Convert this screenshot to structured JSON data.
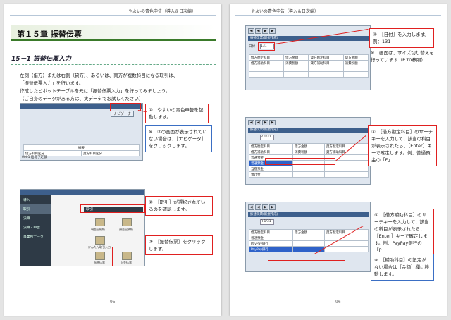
{
  "left_page": {
    "header": "やよいの青色申告（導入＆日次編）",
    "chapter_title": "第１５章 振替伝票",
    "section_title": "15－1 振替伝票入力",
    "body": [
      "左側（借方）または右側（貸方）、あるいは、両方が複数科目になる取引は、",
      "「振替伝票入力」を行います。",
      "作成したピボットテーブルを元に「振替伝票入力」を行ってみましょう。",
      "（ご自身のデータがある方は、実データでお試しください）"
    ],
    "shot1": {
      "nav_label": "ナビゲータ",
      "row_label": "摘要",
      "col1": "借方科目区分",
      "col2": "貸方科目区分",
      "bottom": "0001 給与予定額"
    },
    "callouts": [
      "①　やよいの青色申告を起動します。",
      "※　②の画面が表示されていない場合は、［ナビゲータ］をクリックします。",
      "②　［取引］が選択されているのを確認します。",
      "③　［振替伝票］をクリックします。"
    ],
    "shot2": {
      "menu": [
        "導入",
        "取引",
        "決算",
        "決算・申告",
        "事業所データ"
      ],
      "tab": "取引",
      "icons": [
        "現金出納帳",
        "預金出納帳",
        "かんたん取引入力",
        "振替伝票",
        "入金伝票"
      ]
    },
    "page_number": "95"
  },
  "right_page": {
    "header": "やよいの青色申告（導入＆日次編）",
    "shots": [
      {
        "title": "振替伝票(新規作成)",
        "date": "131",
        "headers": [
          "借方勘定科目",
          "借方金額",
          "貸方勘定科目",
          "貸方金額"
        ],
        "sub": [
          "借方補助科目",
          "消費税額",
          "貸方補助科目",
          "消費税額"
        ]
      },
      {
        "title": "振替伝票(新規作成)",
        "date": "R 1/31",
        "headers": [
          "借方勘定科目",
          "借方金額",
          "貸方勘定科目"
        ],
        "sub": [
          "借方補助科目",
          "消費税額",
          "貸方補助科目"
        ],
        "rows": [
          "普通預金",
          "普通預金",
          "当座預金",
          "預け金"
        ]
      },
      {
        "title": "振替伝票(新規作成)",
        "date": "R 1/31",
        "headers": [
          "借方勘定科目",
          "借方金額",
          "貸方勘定科目"
        ],
        "rows": [
          "普通預金",
          "PayPay銀行",
          "PayPay銀行"
        ]
      }
    ],
    "callouts": [
      "④　［日付］を入力します。例：131",
      "※　画面は、サイズ切り替えを行っています（P.70参照）",
      "⑤　［借方勘定科目］のサーチキーを入力して、該当の科目が表示されたら、［Enter］キーで確定します。例：普通預金の「F」",
      "⑥　［借方補助科目］のサーチキーを入力して、該当の科目が表示されたら、［Enter］キーで確定します。例：PayPay銀行の「P」",
      "※　［補助科目］の設定がない場合は［金額］欄に移動します。"
    ],
    "page_number": "96"
  }
}
